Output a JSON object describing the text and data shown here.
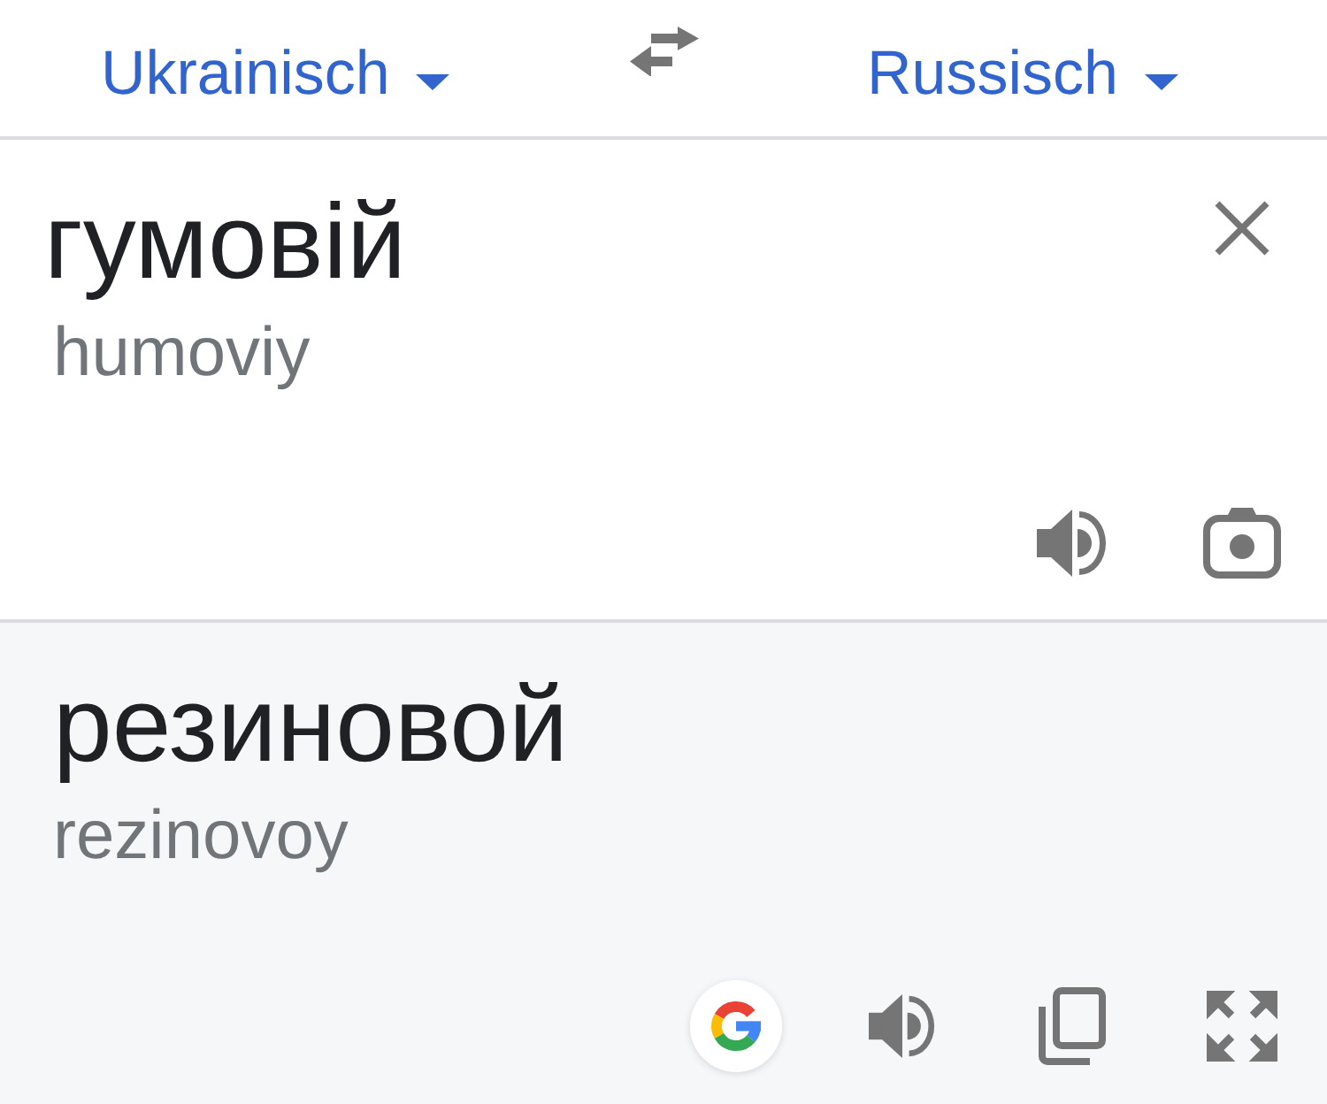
{
  "header": {
    "source_language": "Ukrainisch",
    "target_language": "Russisch"
  },
  "source": {
    "text": "гумовій",
    "transliteration": "humoviy"
  },
  "translation": {
    "text": "резиновой",
    "transliteration": "rezinovoy"
  }
}
